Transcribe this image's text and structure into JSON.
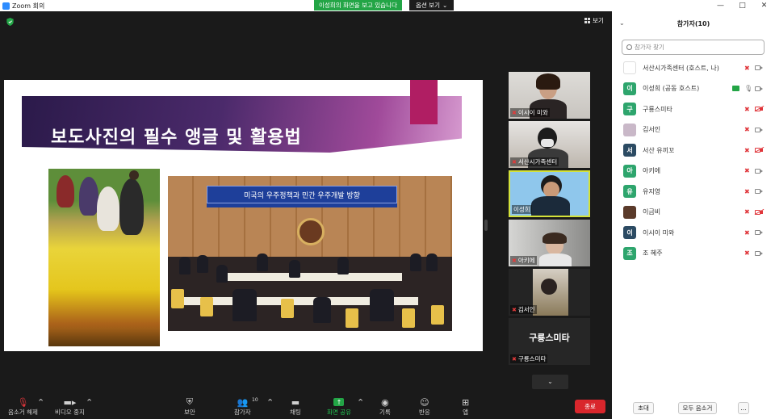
{
  "titlebar": {
    "app_title": "Zoom 회의",
    "window_controls": [
      "—",
      "□",
      "✕"
    ]
  },
  "share_banner": {
    "text": "이성희의 화면을 보고 있습니다",
    "view_options": "옵션 보기"
  },
  "meeting": {
    "view_button": "보기",
    "slide": {
      "title": "보도사진의 필수 앵글 및 활용법",
      "photo_banner": "미국의 우주정책과 민간 우주개발 방향"
    },
    "thumbnails": [
      {
        "name": "이시이 미와",
        "style": "video"
      },
      {
        "name": "서산시가족센터",
        "style": "video"
      },
      {
        "name": "이성희",
        "style": "video-active"
      },
      {
        "name": "아키에",
        "style": "video"
      },
      {
        "name": "김서인",
        "style": "video"
      },
      {
        "name": "구룡스미타",
        "style": "name-only"
      }
    ],
    "scroll_down": "⌄"
  },
  "toolbar": {
    "mute": "음소거 해제",
    "video": "비디오 중지",
    "security": "보안",
    "participants": "참가자",
    "participants_count": "10",
    "chat": "채팅",
    "share": "화면 공유",
    "record": "기록",
    "reactions": "반응",
    "apps": "앱",
    "end": "종료"
  },
  "panel": {
    "title": "참가자(10)",
    "search_placeholder": "참가자 찾기",
    "participants": [
      {
        "name": "서산시가족센터 (호스트, 나)",
        "avatar": "",
        "color": "#ffffff",
        "mic": "muted",
        "cam": "on"
      },
      {
        "name": "이성희 (공동 호스트)",
        "avatar": "이",
        "color": "#2ea56d",
        "mic": "on",
        "cam": "on",
        "sharing": true
      },
      {
        "name": "구룡스미타",
        "avatar": "구",
        "color": "#2ea56d",
        "mic": "muted",
        "cam": "off"
      },
      {
        "name": "김서인",
        "avatar": "",
        "color": "#c9b8c8",
        "mic": "muted",
        "cam": "on"
      },
      {
        "name": "서산 유끼꼬",
        "avatar": "서",
        "color": "#2c4b63",
        "mic": "muted",
        "cam": "off"
      },
      {
        "name": "아키에",
        "avatar": "아",
        "color": "#2ea56d",
        "mic": "muted",
        "cam": "on"
      },
      {
        "name": "유지영",
        "avatar": "유",
        "color": "#2ea56d",
        "mic": "muted",
        "cam": "on"
      },
      {
        "name": "이금비",
        "avatar": "",
        "color": "#5a3a2a",
        "mic": "muted",
        "cam": "off"
      },
      {
        "name": "이시이 미와",
        "avatar": "이",
        "color": "#2c4b63",
        "mic": "muted",
        "cam": "on"
      },
      {
        "name": "조 혜주",
        "avatar": "조",
        "color": "#2ea56d",
        "mic": "muted",
        "cam": "on"
      }
    ],
    "footer": {
      "invite": "초대",
      "mute_all": "모두 음소거",
      "more": "..."
    }
  },
  "colors": {
    "share_green": "#23a546",
    "end_red": "#d9262c",
    "active_border": "#d4e23a",
    "muted_red": "#e0363b"
  }
}
